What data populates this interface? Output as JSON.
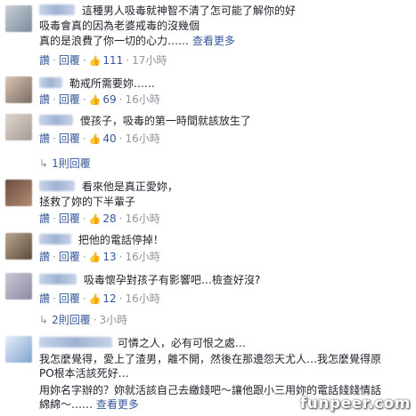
{
  "comments": [
    {
      "lines": [
        "這種男人吸毒就神智不清了怎可能了解你的好",
        "吸毒會真的因為老婆戒毒的沒幾個",
        "真的是浪費了你一切的心力……"
      ],
      "see_more": "查看更多",
      "actions": {
        "read": "讚",
        "reply": "回覆",
        "likes": "111",
        "time": "17小時"
      }
    },
    {
      "lines": [
        "勒戒所需要妳……"
      ],
      "actions": {
        "read": "讚",
        "reply": "回覆",
        "likes": "69",
        "time": "16小時"
      }
    },
    {
      "lines": [
        "傻孩子，吸毒的第一時間就該放生了"
      ],
      "actions": {
        "read": "讚",
        "reply": "回覆",
        "likes": "40",
        "time": "16小時"
      },
      "replies": "1則回覆"
    },
    {
      "lines": [
        "看來他是真正愛妳，",
        "拯救了妳的下半輩子"
      ],
      "actions": {
        "read": "讚",
        "reply": "回覆",
        "likes": "28",
        "time": "16小時"
      }
    },
    {
      "lines": [
        "把他的電話停掉！"
      ],
      "actions": {
        "read": "讚",
        "reply": "回覆",
        "likes": "13",
        "time": "16小時"
      }
    },
    {
      "lines": [
        "吸毒懷孕對孩子有影響吧…檢查好沒?"
      ],
      "actions": {
        "read": "讚",
        "reply": "回覆",
        "likes": "12",
        "time": "16小時"
      },
      "replies": "2則回覆",
      "replies_time": "3小時"
    },
    {
      "lines": [
        "可憐之人，必有可恨之處…",
        "我怎麼覺得，愛上了渣男，離不開，然後在那邊怨天尤人…我怎麼覺得原",
        "PO根本活該死好…",
        "用妳名字辦的？妳就活該自己去繳錢吧～讓他跟小三用妳的電話錢錢情話",
        "綿綿～……"
      ],
      "see_more": "查看更多"
    }
  ],
  "watermark": "funpeer.com"
}
